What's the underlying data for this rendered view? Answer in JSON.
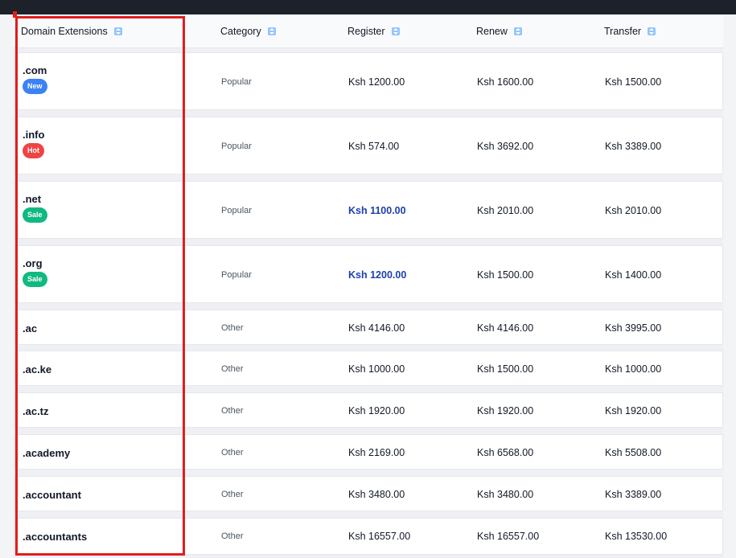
{
  "header": {
    "col_domain": "Domain Extensions",
    "col_category": "Category",
    "col_register": "Register",
    "col_renew": "Renew",
    "col_transfer": "Transfer"
  },
  "rows": [
    {
      "tld": ".com",
      "badge": "New",
      "badge_color": "#3b82f6",
      "category": "Popular",
      "register": "Ksh 1200.00",
      "renew": "Ksh 1600.00",
      "transfer": "Ksh 1500.00",
      "sale": false
    },
    {
      "tld": ".info",
      "badge": "Hot",
      "badge_color": "#ef4444",
      "category": "Popular",
      "register": "Ksh 574.00",
      "renew": "Ksh 3692.00",
      "transfer": "Ksh 3389.00",
      "sale": false
    },
    {
      "tld": ".net",
      "badge": "Sale",
      "badge_color": "#10b981",
      "category": "Popular",
      "register": "Ksh 1100.00",
      "renew": "Ksh 2010.00",
      "transfer": "Ksh 2010.00",
      "sale": true
    },
    {
      "tld": ".org",
      "badge": "Sale",
      "badge_color": "#10b981",
      "category": "Popular",
      "register": "Ksh 1200.00",
      "renew": "Ksh 1500.00",
      "transfer": "Ksh 1400.00",
      "sale": true
    },
    {
      "tld": ".ac",
      "category": "Other",
      "register": "Ksh 4146.00",
      "renew": "Ksh 4146.00",
      "transfer": "Ksh 3995.00",
      "sale": false
    },
    {
      "tld": ".ac.ke",
      "category": "Other",
      "register": "Ksh 1000.00",
      "renew": "Ksh 1500.00",
      "transfer": "Ksh 1000.00",
      "sale": false
    },
    {
      "tld": ".ac.tz",
      "category": "Other",
      "register": "Ksh 1920.00",
      "renew": "Ksh 1920.00",
      "transfer": "Ksh 1920.00",
      "sale": false
    },
    {
      "tld": ".academy",
      "category": "Other",
      "register": "Ksh 2169.00",
      "renew": "Ksh 6568.00",
      "transfer": "Ksh 5508.00",
      "sale": false
    },
    {
      "tld": ".accountant",
      "category": "Other",
      "register": "Ksh 3480.00",
      "renew": "Ksh 3480.00",
      "transfer": "Ksh 3389.00",
      "sale": false
    },
    {
      "tld": ".accountants",
      "category": "Other",
      "register": "Ksh 16557.00",
      "renew": "Ksh 16557.00",
      "transfer": "Ksh 13530.00",
      "sale": false
    }
  ],
  "colors": {
    "highlight": "#e11d1d",
    "sale_price": "#1e40af"
  }
}
